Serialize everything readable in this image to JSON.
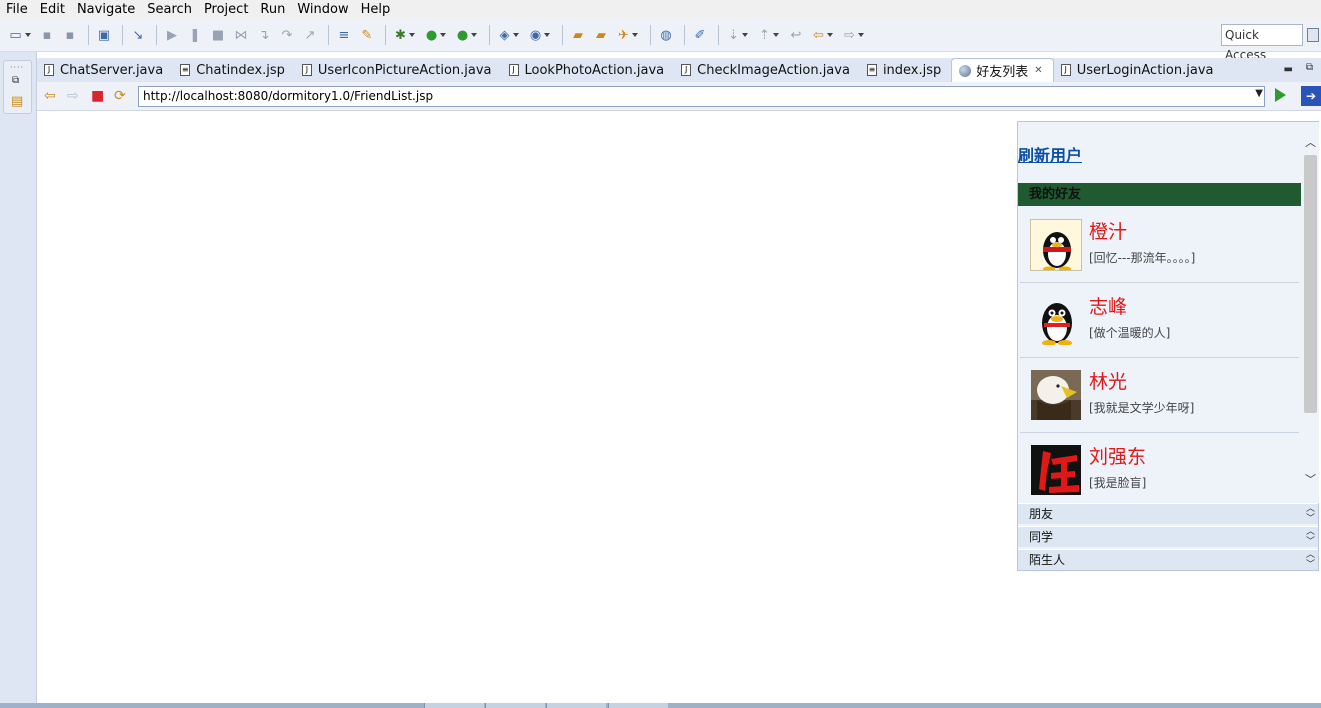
{
  "menu": [
    "File",
    "Edit",
    "Navigate",
    "Search",
    "Project",
    "Run",
    "Window",
    "Help"
  ],
  "toolbar": {
    "quick_access": "Quick Access"
  },
  "tabs": [
    {
      "label": "ChatServer.java",
      "icon": "java-file-icon",
      "active": false
    },
    {
      "label": "Chatindex.jsp",
      "icon": "jsp-file-icon",
      "active": false
    },
    {
      "label": "UserIconPictureAction.java",
      "icon": "java-file-icon",
      "active": false
    },
    {
      "label": "LookPhotoAction.java",
      "icon": "java-file-icon",
      "active": false
    },
    {
      "label": "CheckImageAction.java",
      "icon": "java-file-icon",
      "active": false
    },
    {
      "label": "index.jsp",
      "icon": "jsp-file-icon",
      "active": false
    },
    {
      "label": "好友列表",
      "icon": "globe-icon",
      "active": true
    },
    {
      "label": "UserLoginAction.java",
      "icon": "java-file-icon",
      "active": false
    }
  ],
  "browser": {
    "url": "http://localhost:8080/dormitory1.0/FriendList.jsp"
  },
  "friend_panel": {
    "refresh_label": "刷新用户",
    "my_friends_header": "我的好友",
    "friends": [
      {
        "name": "橙汁",
        "signature": "[回忆---那流年。。。。]",
        "avatar": "penguin-scarf-avatar"
      },
      {
        "name": "志峰",
        "signature": "[做个温暖的人]",
        "avatar": "penguin-avatar"
      },
      {
        "name": "林光",
        "signature": "[我就是文学少年呀]",
        "avatar": "eagle-avatar"
      },
      {
        "name": "刘强东",
        "signature": "[我是脸盲]",
        "avatar": "red-calligraphy-avatar"
      }
    ],
    "groups": [
      "朋友",
      "同学",
      "陌生人"
    ]
  },
  "colors": {
    "header_green": "#1f5a31",
    "name_red": "#e01818",
    "link_blue": "#0b4fa8"
  }
}
